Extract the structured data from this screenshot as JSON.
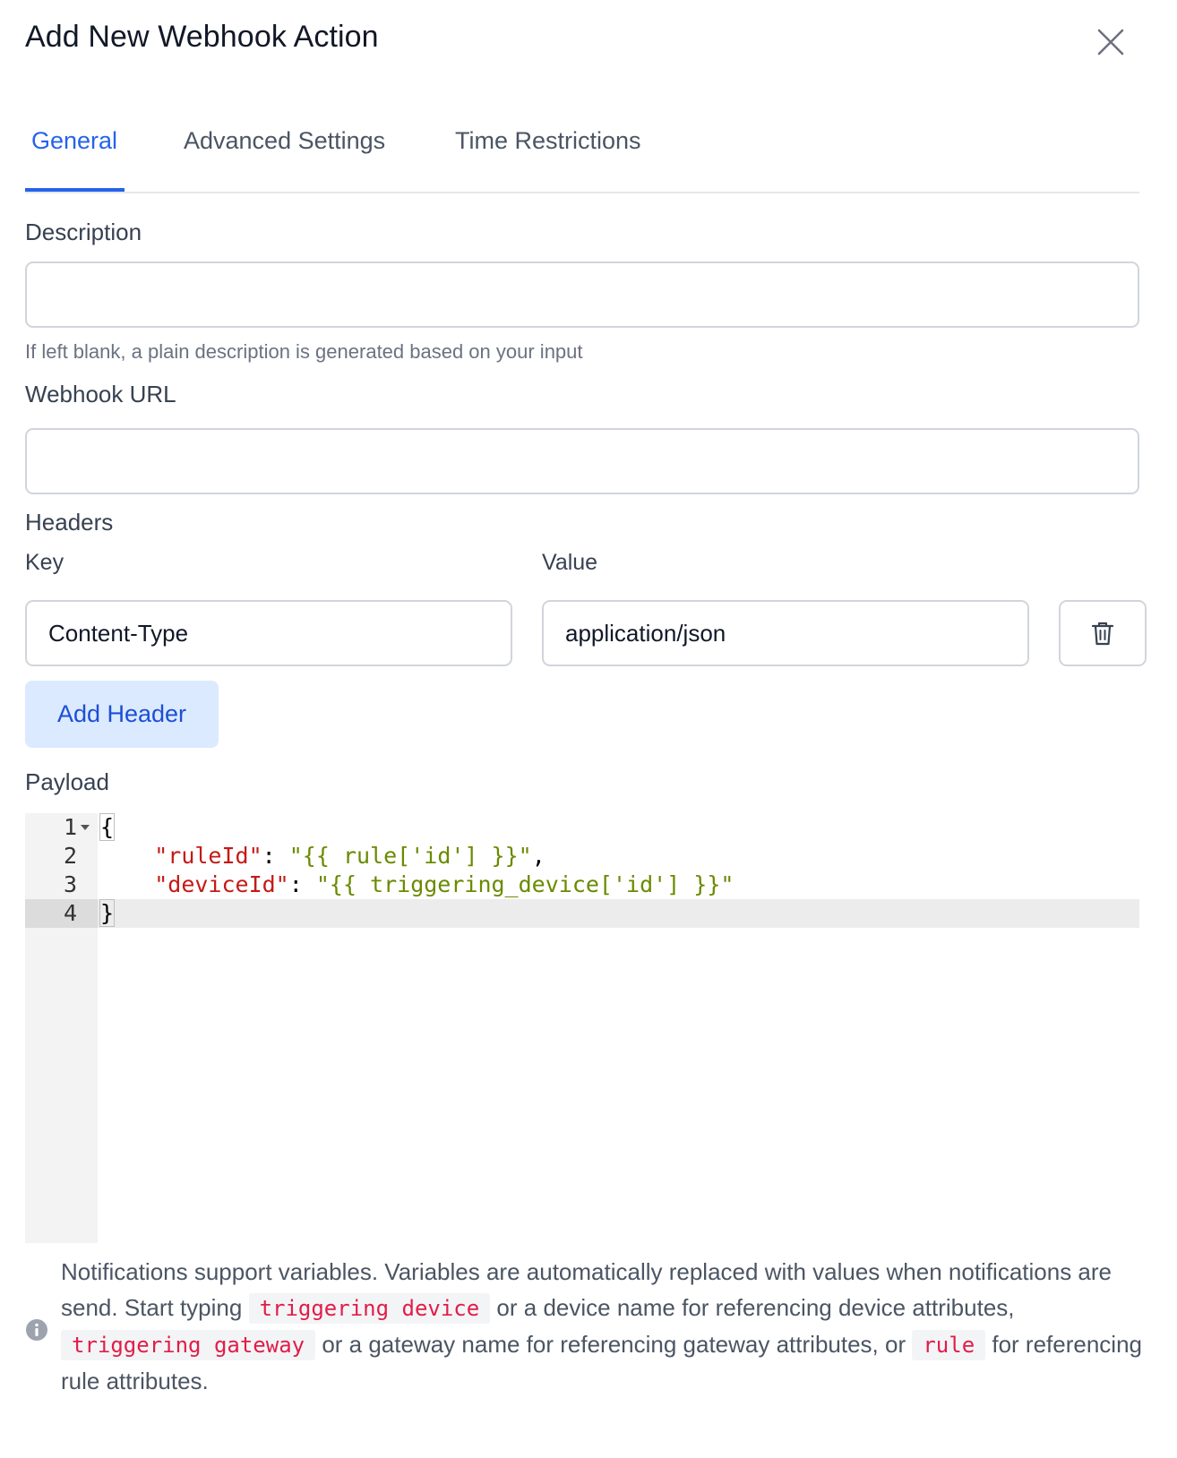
{
  "dialog": {
    "title": "Add New Webhook Action"
  },
  "tabs": [
    {
      "label": "General",
      "active": true
    },
    {
      "label": "Advanced Settings",
      "active": false
    },
    {
      "label": "Time Restrictions",
      "active": false
    }
  ],
  "form": {
    "description": {
      "label": "Description",
      "value": "",
      "helper": "If left blank, a plain description is generated based on your input"
    },
    "webhook_url": {
      "label": "Webhook URL",
      "value": ""
    },
    "headers": {
      "label": "Headers",
      "key_label": "Key",
      "value_label": "Value",
      "rows": [
        {
          "key": "Content-Type",
          "value": "application/json"
        }
      ],
      "add_button": "Add Header"
    },
    "payload": {
      "label": "Payload",
      "line_numbers": [
        "1",
        "2",
        "3",
        "4"
      ],
      "lines": {
        "l1": "{",
        "l2_key": "\"ruleId\"",
        "l2_sep": ": ",
        "l2_val": "\"{{ rule['id'] }}\"",
        "l2_end": ",",
        "l3_key": "\"deviceId\"",
        "l3_sep": ": ",
        "l3_val": "\"{{ triggering_device['id'] }}\"",
        "l4": "}"
      }
    }
  },
  "notice": {
    "part1": "Notifications support variables. Variables are automatically replaced with values when notifications are send. Start typing ",
    "code1": "triggering device",
    "part2": " or a device name for referencing device attributes, ",
    "code2": "triggering gateway",
    "part3": " or a gateway name for referencing gateway attributes, or ",
    "code3": "rule",
    "part4": " for referencing rule attributes."
  },
  "icons": {
    "close": "close-icon",
    "delete": "trash-icon",
    "info": "info-icon",
    "fold": "fold-arrow-icon"
  },
  "colors": {
    "accent": "#2563eb",
    "add_button_bg": "#dbeafe",
    "code_key": "#c41a16",
    "code_string": "#6a8a00",
    "inline_code": "#e11d48"
  }
}
